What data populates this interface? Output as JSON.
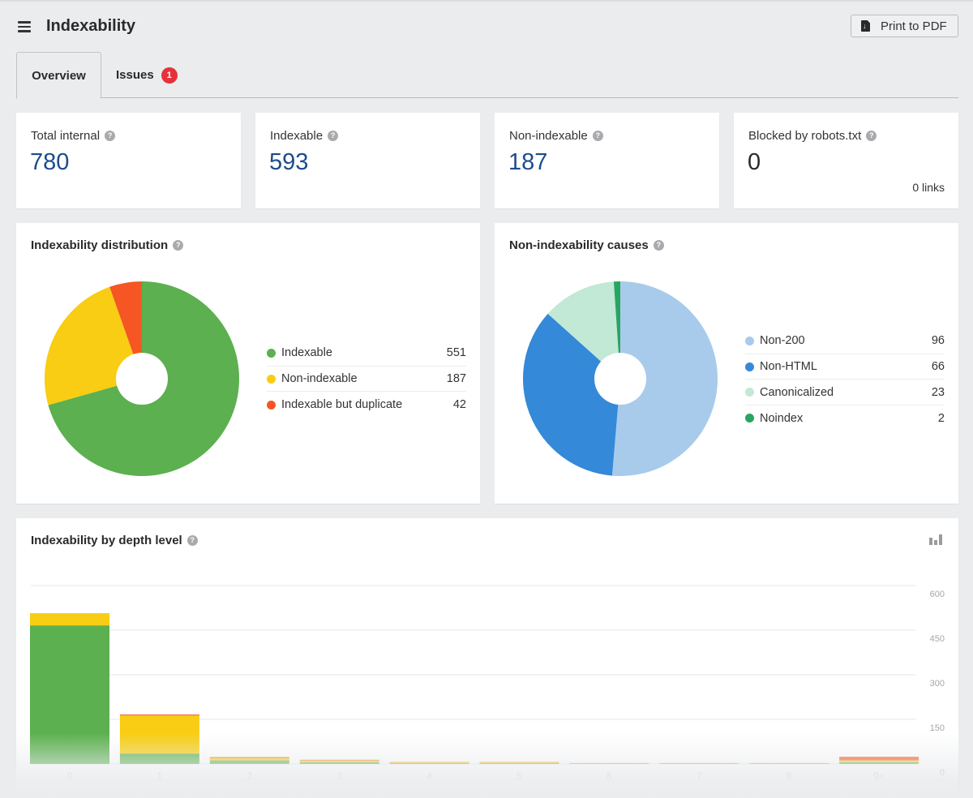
{
  "header": {
    "title": "Indexability",
    "print_button": "Print to PDF"
  },
  "tabs": [
    {
      "label": "Overview",
      "active": true
    },
    {
      "label": "Issues",
      "badge": "1"
    }
  ],
  "stats": [
    {
      "label": "Total internal",
      "value": "780"
    },
    {
      "label": "Indexable",
      "value": "593"
    },
    {
      "label": "Non-indexable",
      "value": "187"
    },
    {
      "label": "Blocked by robots.txt",
      "value": "0",
      "sub": "0 links"
    }
  ],
  "help_glyph": "?",
  "chart_data": [
    {
      "type": "pie",
      "title": "Indexability distribution",
      "donut": true,
      "start_angle": "top, clockwise",
      "slices": [
        {
          "label": "Indexable",
          "value": 551,
          "color": "#5cb04f"
        },
        {
          "label": "Non-indexable",
          "value": 187,
          "color": "#f8cd13"
        },
        {
          "label": "Indexable but duplicate",
          "value": 42,
          "color": "#f55623"
        }
      ]
    },
    {
      "type": "pie",
      "title": "Non-indexability causes",
      "donut": true,
      "start_angle": "top, clockwise",
      "slices": [
        {
          "label": "Non-200",
          "value": 96,
          "color": "#a8cbeb"
        },
        {
          "label": "Non-HTML",
          "value": 66,
          "color": "#3489d8"
        },
        {
          "label": "Canonicalized",
          "value": 23,
          "color": "#c2e8d6"
        },
        {
          "label": "Noindex",
          "value": 2,
          "color": "#27a661"
        }
      ]
    },
    {
      "type": "bar",
      "stacked": true,
      "title": "Indexability by depth level",
      "xlabel": "",
      "ylabel": "",
      "categories": [
        "0",
        "1",
        "2",
        "3",
        "4",
        "5",
        "6",
        "7",
        "8",
        "9+"
      ],
      "yticks": [
        "0",
        "150",
        "300",
        "450",
        "600"
      ],
      "ylim": [
        0,
        600
      ],
      "y_axis_side": "right",
      "grid": true,
      "series": [
        {
          "name": "Indexable",
          "color": "#5cb04f",
          "values": [
            466,
            35,
            12,
            6,
            3,
            3,
            1,
            1,
            1,
            6
          ]
        },
        {
          "name": "Non-indexable",
          "color": "#f8cd13",
          "values": [
            41,
            128,
            8,
            6,
            3,
            3,
            1,
            1,
            1,
            6
          ]
        },
        {
          "name": "Indexable but duplicate",
          "color": "#f55623",
          "values": [
            0,
            3,
            3,
            2,
            1,
            1,
            1,
            1,
            1,
            12
          ]
        }
      ]
    }
  ]
}
